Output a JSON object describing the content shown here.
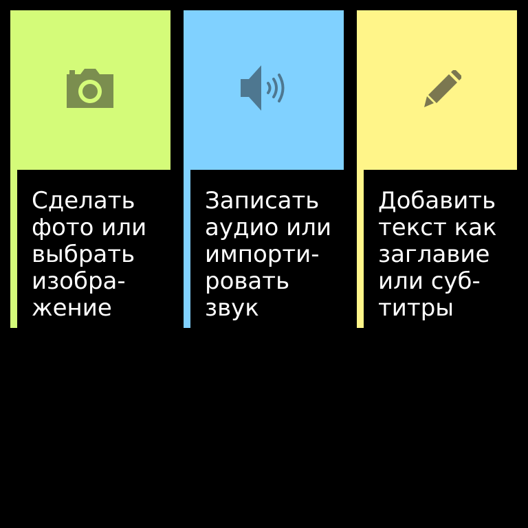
{
  "colors": {
    "background": "#000000",
    "label_text": "#ffffff"
  },
  "cards": [
    {
      "id": "photo",
      "icon": "camera-icon",
      "accent_color": "#d4fb79",
      "icon_color": "#7b8e4f",
      "label": "Сделать\nфото или\nвыбрать\nизобра-\nжение"
    },
    {
      "id": "audio",
      "icon": "speaker-icon",
      "accent_color": "#80d1ff",
      "icon_color": "#4e7790",
      "label": "Записать\nаудио или\nимпорти-\nровать\nзвук"
    },
    {
      "id": "text",
      "icon": "pencil-icon",
      "accent_color": "#fff589",
      "icon_color": "#7b7750",
      "label": "Добавить\nтекст как\nзаглавие\nили суб-\nтитры"
    }
  ]
}
